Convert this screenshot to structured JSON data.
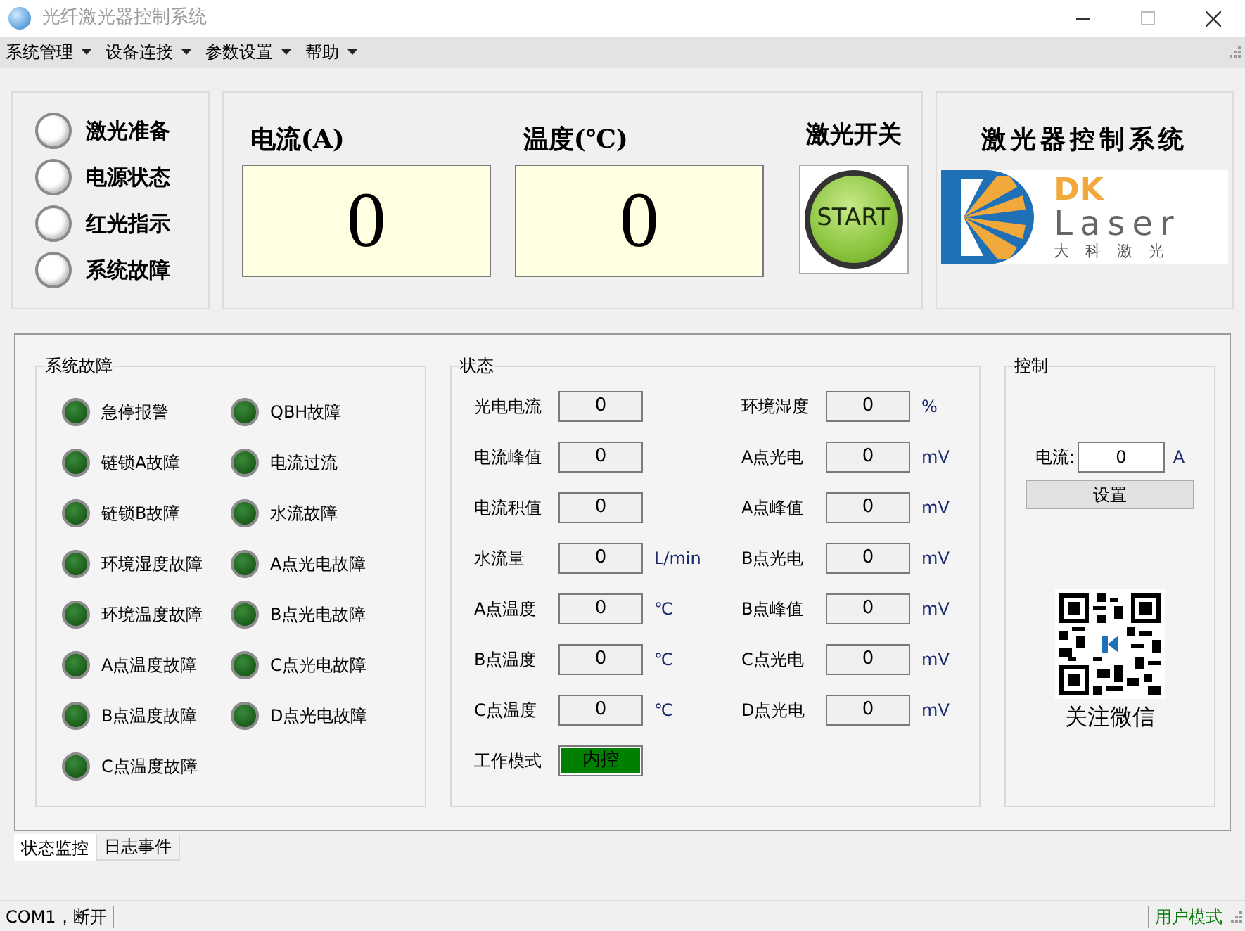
{
  "window": {
    "title": "光纤激光器控制系统"
  },
  "menu": [
    {
      "label": "系统管理"
    },
    {
      "label": "设备连接"
    },
    {
      "label": "参数设置"
    },
    {
      "label": "帮助"
    }
  ],
  "indicators": [
    {
      "label": "激光准备",
      "on": false
    },
    {
      "label": "电源状态",
      "on": false
    },
    {
      "label": "红光指示",
      "on": false
    },
    {
      "label": "系统故障",
      "on": false
    }
  ],
  "readouts": [
    {
      "label": "电流(A)",
      "value": "0"
    },
    {
      "label": "温度(℃)",
      "value": "0"
    }
  ],
  "laser_switch": {
    "label": "激光开关",
    "button": "START"
  },
  "logo": {
    "title": "激光器控制系统",
    "brand_top": "DK",
    "brand_bottom": "Laser",
    "brand_cn": "大 科 激 光"
  },
  "fault_group": {
    "title": "系统故障",
    "items": [
      {
        "label": "急停报警",
        "on": false
      },
      {
        "label": "QBH故障",
        "on": false
      },
      {
        "label": "链锁A故障",
        "on": false
      },
      {
        "label": "电流过流",
        "on": false
      },
      {
        "label": "链锁B故障",
        "on": false
      },
      {
        "label": "水流故障",
        "on": false
      },
      {
        "label": "环境湿度故障",
        "on": false
      },
      {
        "label": "A点光电故障",
        "on": false
      },
      {
        "label": "环境温度故障",
        "on": false
      },
      {
        "label": "B点光电故障",
        "on": false
      },
      {
        "label": "A点温度故障",
        "on": false
      },
      {
        "label": "C点光电故障",
        "on": false
      },
      {
        "label": "B点温度故障",
        "on": false
      },
      {
        "label": "D点光电故障",
        "on": false
      },
      {
        "label": "C点温度故障",
        "on": false
      }
    ]
  },
  "status_group": {
    "title": "状态",
    "rows": [
      {
        "kind": "value",
        "label": "光电电流",
        "value": "0"
      },
      {
        "kind": "value",
        "label": "环境湿度",
        "value": "0",
        "unit": "%"
      },
      {
        "kind": "value",
        "label": "电流峰值",
        "value": "0"
      },
      {
        "kind": "value",
        "label": "A点光电",
        "value": "0",
        "unit": "mV"
      },
      {
        "kind": "value",
        "label": "电流积值",
        "value": "0"
      },
      {
        "kind": "value",
        "label": "A点峰值",
        "value": "0",
        "unit": "mV"
      },
      {
        "kind": "value",
        "label": "水流量",
        "value": "0",
        "unit": "L/min"
      },
      {
        "kind": "value",
        "label": "B点光电",
        "value": "0",
        "unit": "mV"
      },
      {
        "kind": "value",
        "label": "A点温度",
        "value": "0",
        "unit": "℃"
      },
      {
        "kind": "value",
        "label": "B点峰值",
        "value": "0",
        "unit": "mV"
      },
      {
        "kind": "value",
        "label": "B点温度",
        "value": "0",
        "unit": "℃"
      },
      {
        "kind": "value",
        "label": "C点光电",
        "value": "0",
        "unit": "mV"
      },
      {
        "kind": "value",
        "label": "C点温度",
        "value": "0",
        "unit": "℃"
      },
      {
        "kind": "value",
        "label": "D点光电",
        "value": "0",
        "unit": "mV"
      },
      {
        "kind": "mode",
        "label": "工作模式",
        "value": "内控"
      }
    ]
  },
  "control_group": {
    "title": "控制",
    "current_label": "电流:",
    "current_value": "0",
    "current_unit": "A",
    "button": "设置",
    "qr_caption": "关注微信"
  },
  "tabs": [
    {
      "label": "状态监控",
      "selected": true
    },
    {
      "label": "日志事件",
      "selected": false
    }
  ],
  "status_bar": {
    "left": "COM1，断开",
    "right": "用户模式"
  }
}
